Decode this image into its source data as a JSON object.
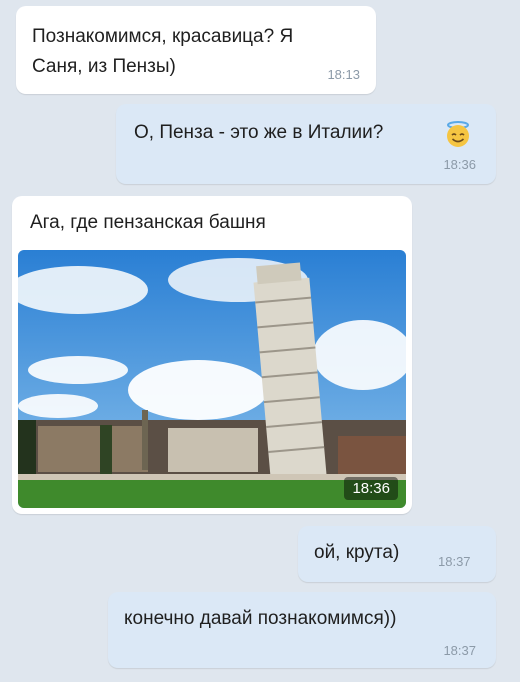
{
  "messages": [
    {
      "text": "Познакомимся, красавица? Я Саня, из Пензы)",
      "time": "18:13"
    },
    {
      "text": "О, Пенза - это же в Италии?",
      "emoji": "smiling-face-with-halo",
      "time": "18:36"
    },
    {
      "text": "Ага, где пензанская башня",
      "photo_time": "18:36"
    },
    {
      "text": "ой, крута)",
      "time": "18:37"
    },
    {
      "text": "конечно давай познакомимся))",
      "time": "18:37"
    }
  ],
  "colors": {
    "background": "#dfe6ee",
    "incoming_bubble": "#ffffff",
    "outgoing_bubble": "#dbe8f6",
    "time_text": "#8c9aa8"
  }
}
